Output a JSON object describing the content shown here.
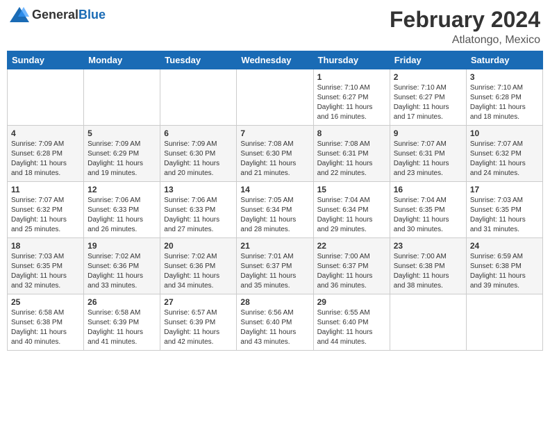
{
  "logo": {
    "general": "General",
    "blue": "Blue"
  },
  "header": {
    "month": "February 2024",
    "location": "Atlatongo, Mexico"
  },
  "weekdays": [
    "Sunday",
    "Monday",
    "Tuesday",
    "Wednesday",
    "Thursday",
    "Friday",
    "Saturday"
  ],
  "weeks": [
    [
      {
        "day": "",
        "info": ""
      },
      {
        "day": "",
        "info": ""
      },
      {
        "day": "",
        "info": ""
      },
      {
        "day": "",
        "info": ""
      },
      {
        "day": "1",
        "info": "Sunrise: 7:10 AM\nSunset: 6:27 PM\nDaylight: 11 hours\nand 16 minutes."
      },
      {
        "day": "2",
        "info": "Sunrise: 7:10 AM\nSunset: 6:27 PM\nDaylight: 11 hours\nand 17 minutes."
      },
      {
        "day": "3",
        "info": "Sunrise: 7:10 AM\nSunset: 6:28 PM\nDaylight: 11 hours\nand 18 minutes."
      }
    ],
    [
      {
        "day": "4",
        "info": "Sunrise: 7:09 AM\nSunset: 6:28 PM\nDaylight: 11 hours\nand 18 minutes."
      },
      {
        "day": "5",
        "info": "Sunrise: 7:09 AM\nSunset: 6:29 PM\nDaylight: 11 hours\nand 19 minutes."
      },
      {
        "day": "6",
        "info": "Sunrise: 7:09 AM\nSunset: 6:30 PM\nDaylight: 11 hours\nand 20 minutes."
      },
      {
        "day": "7",
        "info": "Sunrise: 7:08 AM\nSunset: 6:30 PM\nDaylight: 11 hours\nand 21 minutes."
      },
      {
        "day": "8",
        "info": "Sunrise: 7:08 AM\nSunset: 6:31 PM\nDaylight: 11 hours\nand 22 minutes."
      },
      {
        "day": "9",
        "info": "Sunrise: 7:07 AM\nSunset: 6:31 PM\nDaylight: 11 hours\nand 23 minutes."
      },
      {
        "day": "10",
        "info": "Sunrise: 7:07 AM\nSunset: 6:32 PM\nDaylight: 11 hours\nand 24 minutes."
      }
    ],
    [
      {
        "day": "11",
        "info": "Sunrise: 7:07 AM\nSunset: 6:32 PM\nDaylight: 11 hours\nand 25 minutes."
      },
      {
        "day": "12",
        "info": "Sunrise: 7:06 AM\nSunset: 6:33 PM\nDaylight: 11 hours\nand 26 minutes."
      },
      {
        "day": "13",
        "info": "Sunrise: 7:06 AM\nSunset: 6:33 PM\nDaylight: 11 hours\nand 27 minutes."
      },
      {
        "day": "14",
        "info": "Sunrise: 7:05 AM\nSunset: 6:34 PM\nDaylight: 11 hours\nand 28 minutes."
      },
      {
        "day": "15",
        "info": "Sunrise: 7:04 AM\nSunset: 6:34 PM\nDaylight: 11 hours\nand 29 minutes."
      },
      {
        "day": "16",
        "info": "Sunrise: 7:04 AM\nSunset: 6:35 PM\nDaylight: 11 hours\nand 30 minutes."
      },
      {
        "day": "17",
        "info": "Sunrise: 7:03 AM\nSunset: 6:35 PM\nDaylight: 11 hours\nand 31 minutes."
      }
    ],
    [
      {
        "day": "18",
        "info": "Sunrise: 7:03 AM\nSunset: 6:35 PM\nDaylight: 11 hours\nand 32 minutes."
      },
      {
        "day": "19",
        "info": "Sunrise: 7:02 AM\nSunset: 6:36 PM\nDaylight: 11 hours\nand 33 minutes."
      },
      {
        "day": "20",
        "info": "Sunrise: 7:02 AM\nSunset: 6:36 PM\nDaylight: 11 hours\nand 34 minutes."
      },
      {
        "day": "21",
        "info": "Sunrise: 7:01 AM\nSunset: 6:37 PM\nDaylight: 11 hours\nand 35 minutes."
      },
      {
        "day": "22",
        "info": "Sunrise: 7:00 AM\nSunset: 6:37 PM\nDaylight: 11 hours\nand 36 minutes."
      },
      {
        "day": "23",
        "info": "Sunrise: 7:00 AM\nSunset: 6:38 PM\nDaylight: 11 hours\nand 38 minutes."
      },
      {
        "day": "24",
        "info": "Sunrise: 6:59 AM\nSunset: 6:38 PM\nDaylight: 11 hours\nand 39 minutes."
      }
    ],
    [
      {
        "day": "25",
        "info": "Sunrise: 6:58 AM\nSunset: 6:38 PM\nDaylight: 11 hours\nand 40 minutes."
      },
      {
        "day": "26",
        "info": "Sunrise: 6:58 AM\nSunset: 6:39 PM\nDaylight: 11 hours\nand 41 minutes."
      },
      {
        "day": "27",
        "info": "Sunrise: 6:57 AM\nSunset: 6:39 PM\nDaylight: 11 hours\nand 42 minutes."
      },
      {
        "day": "28",
        "info": "Sunrise: 6:56 AM\nSunset: 6:40 PM\nDaylight: 11 hours\nand 43 minutes."
      },
      {
        "day": "29",
        "info": "Sunrise: 6:55 AM\nSunset: 6:40 PM\nDaylight: 11 hours\nand 44 minutes."
      },
      {
        "day": "",
        "info": ""
      },
      {
        "day": "",
        "info": ""
      }
    ]
  ]
}
